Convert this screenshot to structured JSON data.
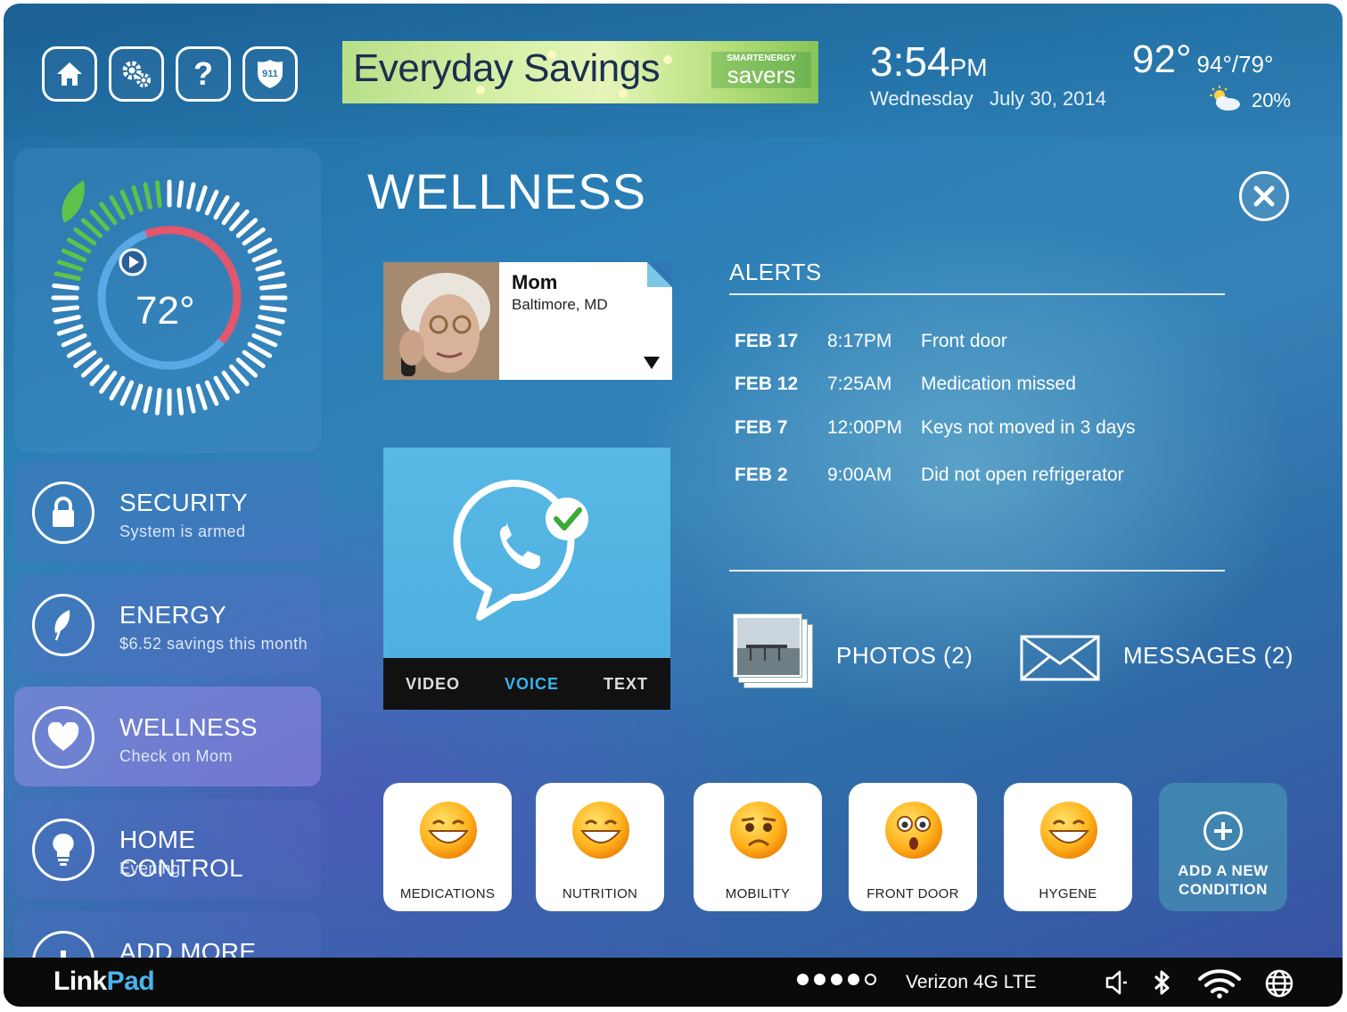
{
  "topbar": {
    "buttons": [
      "home",
      "settings",
      "help",
      "911"
    ],
    "btn_911_label": "911",
    "help_label": "?",
    "ad": {
      "headline": "Everyday Savings",
      "brand_line1": "SMARTENERGY",
      "brand_line2": "savers"
    },
    "clock": {
      "time": "3:54",
      "ampm": "PM",
      "date": "Wednesday   July 30, 2014"
    },
    "weather": {
      "current": "92°",
      "range": "94°/79°",
      "precip": "20%",
      "icon": "partly-cloudy-icon"
    }
  },
  "sidebar": {
    "thermostat": {
      "temperature": "72°",
      "accent_colors": [
        "#5fc24a",
        "#e3566b",
        "#5aa8e6"
      ]
    },
    "items": [
      {
        "title": "SECURITY",
        "subtitle": "System is armed",
        "icon": "lock-icon"
      },
      {
        "title": "ENERGY",
        "subtitle": "$6.52 savings this month",
        "icon": "leaf-icon"
      },
      {
        "title": "WELLNESS",
        "subtitle": "Check on Mom",
        "icon": "heart-icon"
      },
      {
        "title": "HOME CONTROL",
        "subtitle": "Evening",
        "icon": "lightbulb-icon"
      },
      {
        "title": "ADD MORE APPS",
        "subtitle": "",
        "icon": "plus-icon"
      }
    ]
  },
  "main": {
    "title": "WELLNESS",
    "contact": {
      "name": "Mom",
      "location": "Baltimore, MD"
    },
    "call": {
      "tabs": [
        "VIDEO",
        "VOICE",
        "TEXT"
      ],
      "active_tab": "VOICE"
    },
    "alerts": {
      "heading": "ALERTS",
      "rows": [
        {
          "date": "FEB 17",
          "time": "8:17PM",
          "desc": "Front door"
        },
        {
          "date": "FEB 12",
          "time": "7:25AM",
          "desc": "Medication missed"
        },
        {
          "date": "FEB 7",
          "time": "12:00PM",
          "desc": "Keys not moved in 3 days"
        },
        {
          "date": "FEB 2",
          "time": "9:00AM",
          "desc": "Did not open refrigerator"
        }
      ]
    },
    "photos_label": "PHOTOS (2)",
    "messages_label": "MESSAGES (2)",
    "conditions": [
      {
        "label": "MEDICATIONS",
        "mood": "happy"
      },
      {
        "label": "NUTRITION",
        "mood": "happy"
      },
      {
        "label": "MOBILITY",
        "mood": "sad"
      },
      {
        "label": "FRONT DOOR",
        "mood": "surprised"
      },
      {
        "label": "HYGENE",
        "mood": "happy"
      }
    ],
    "add_condition": {
      "line1": "ADD A NEW",
      "line2": "CONDITION"
    }
  },
  "statusbar": {
    "brand_link": "Link",
    "brand_pad": "Pad",
    "signal_bars_filled": 4,
    "signal_bars_total": 5,
    "carrier": "Verizon 4G LTE",
    "icons": [
      "speaker-icon",
      "bluetooth-icon",
      "wifi-icon",
      "globe-icon"
    ]
  }
}
